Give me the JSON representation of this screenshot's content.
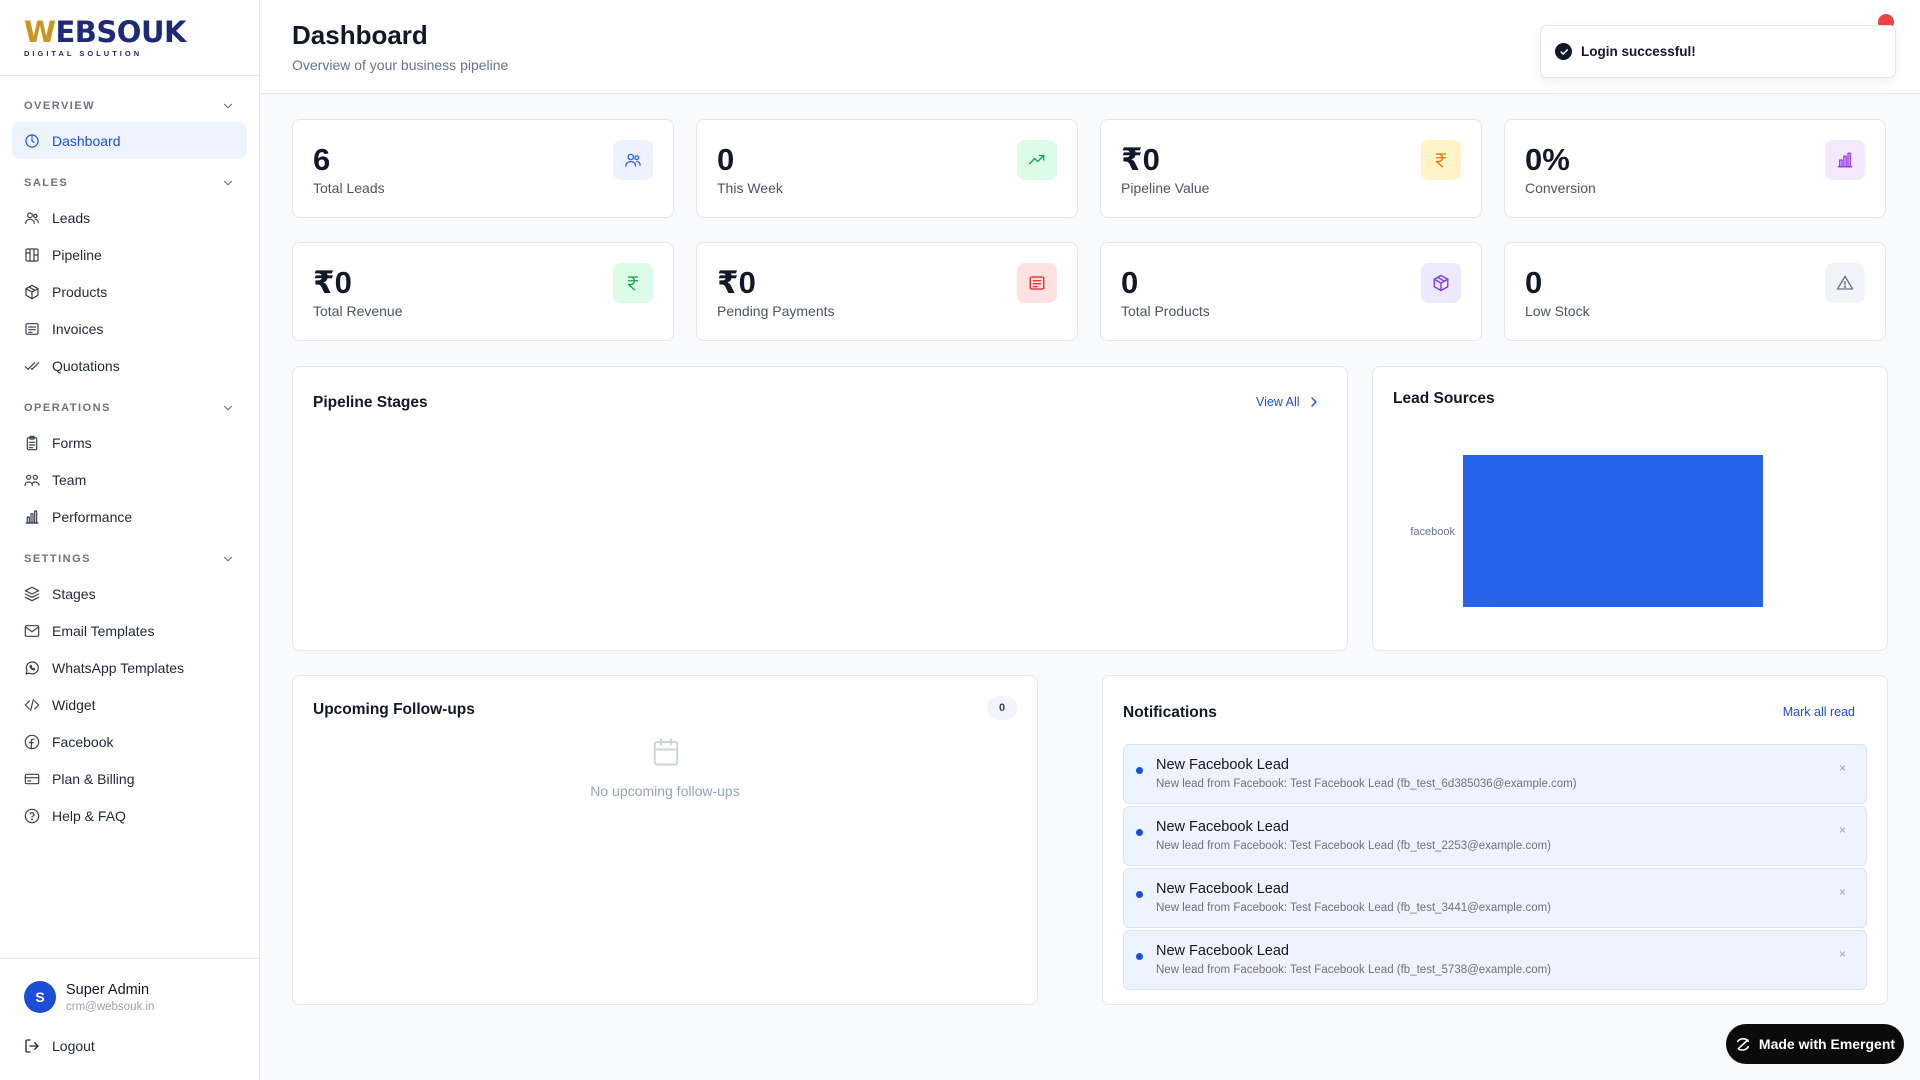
{
  "brand": {
    "logo_main": "EBSOUK",
    "logo_w": "W",
    "logo_sub": "DIGITAL SOLUTION"
  },
  "sidebar": {
    "sections": [
      {
        "title": "OVERVIEW",
        "items": [
          {
            "label": "Dashboard",
            "icon": "dashboard-icon",
            "active": true
          }
        ]
      },
      {
        "title": "SALES",
        "items": [
          {
            "label": "Leads",
            "icon": "users-icon"
          },
          {
            "label": "Pipeline",
            "icon": "kanban-icon"
          },
          {
            "label": "Products",
            "icon": "package-icon"
          },
          {
            "label": "Invoices",
            "icon": "receipt-icon"
          },
          {
            "label": "Quotations",
            "icon": "checks-icon"
          }
        ]
      },
      {
        "title": "OPERATIONS",
        "items": [
          {
            "label": "Forms",
            "icon": "clipboard-icon"
          },
          {
            "label": "Team",
            "icon": "team-icon"
          },
          {
            "label": "Performance",
            "icon": "bar-chart-icon"
          }
        ]
      },
      {
        "title": "SETTINGS",
        "items": [
          {
            "label": "Stages",
            "icon": "layers-icon"
          },
          {
            "label": "Email Templates",
            "icon": "mail-icon"
          },
          {
            "label": "WhatsApp Templates",
            "icon": "whatsapp-icon"
          },
          {
            "label": "Widget",
            "icon": "code-icon"
          },
          {
            "label": "Facebook",
            "icon": "facebook-icon"
          },
          {
            "label": "Plan & Billing",
            "icon": "credit-card-icon"
          },
          {
            "label": "Help & FAQ",
            "icon": "help-icon"
          }
        ]
      }
    ]
  },
  "user": {
    "initial": "S",
    "name": "Super Admin",
    "email": "crm@websouk.in",
    "logout_label": "Logout"
  },
  "header": {
    "title": "Dashboard",
    "subtitle": "Overview of your business pipeline"
  },
  "toast": {
    "message": "Login successful!"
  },
  "stats": [
    {
      "value": "6",
      "label": "Total Leads",
      "icon": "users-icon",
      "icon_bg": "#eef2ff",
      "icon_color": "#2563eb"
    },
    {
      "value": "0",
      "label": "This Week",
      "icon": "trending-up-icon",
      "icon_bg": "#dcfce7",
      "icon_color": "#16a34a"
    },
    {
      "value": "₹0",
      "label": "Pipeline Value",
      "icon": "rupee-icon",
      "icon_bg": "#fef3c7",
      "icon_color": "#d97706"
    },
    {
      "value": "0%",
      "label": "Conversion",
      "icon": "bar-chart-icon",
      "icon_bg": "#f3e8ff",
      "icon_color": "#9333ea"
    },
    {
      "value": "₹0",
      "label": "Total Revenue",
      "icon": "rupee-icon",
      "icon_bg": "#dcfce7",
      "icon_color": "#16a34a"
    },
    {
      "value": "₹0",
      "label": "Pending Payments",
      "icon": "receipt-icon",
      "icon_bg": "#fee2e2",
      "icon_color": "#dc2626"
    },
    {
      "value": "0",
      "label": "Total Products",
      "icon": "package-icon",
      "icon_bg": "#ede9fe",
      "icon_color": "#7c3aed"
    },
    {
      "value": "0",
      "label": "Low Stock",
      "icon": "alert-triangle-icon",
      "icon_bg": "#f1f5f9",
      "icon_color": "#64748b"
    }
  ],
  "pipeline": {
    "title": "Pipeline Stages",
    "view_all": "View All"
  },
  "lead_sources": {
    "title": "Lead Sources"
  },
  "chart_data": {
    "type": "bar",
    "orientation": "horizontal",
    "categories": [
      "facebook"
    ],
    "values": [
      6
    ],
    "title": "Lead Sources",
    "xlabel": "",
    "ylabel": "",
    "grid": false,
    "color": "#2563eb"
  },
  "followups": {
    "title": "Upcoming Follow-ups",
    "count": "0",
    "empty": "No upcoming follow-ups"
  },
  "notifications": {
    "title": "Notifications",
    "mark_all": "Mark all read",
    "items": [
      {
        "title": "New Facebook Lead",
        "desc": "New lead from Facebook: Test Facebook Lead (fb_test_6d385036@example.com)"
      },
      {
        "title": "New Facebook Lead",
        "desc": "New lead from Facebook: Test Facebook Lead (fb_test_2253@example.com)"
      },
      {
        "title": "New Facebook Lead",
        "desc": "New lead from Facebook: Test Facebook Lead (fb_test_3441@example.com)"
      },
      {
        "title": "New Facebook Lead",
        "desc": "New lead from Facebook: Test Facebook Lead (fb_test_5738@example.com)"
      }
    ],
    "close_glyph": "×"
  },
  "emergent": {
    "label": "Made with Emergent"
  }
}
